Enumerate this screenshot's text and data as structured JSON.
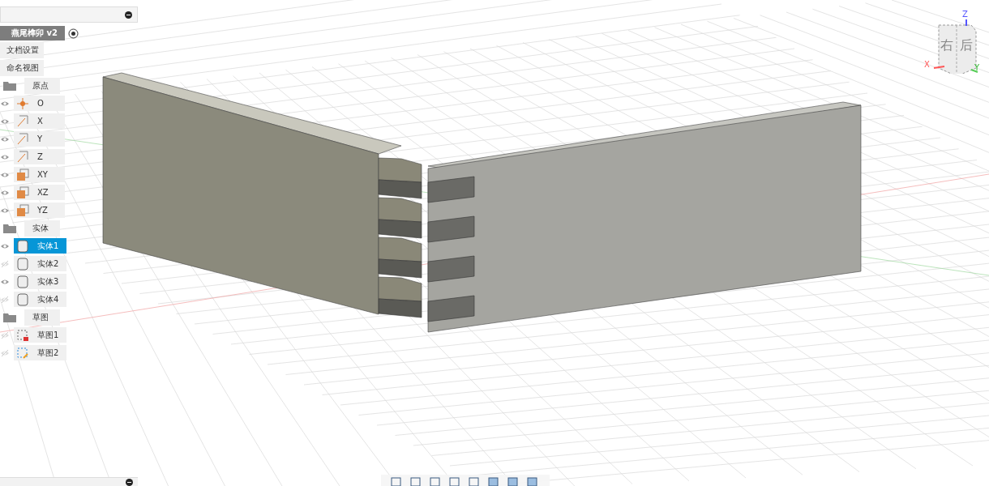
{
  "browser": {
    "document": {
      "title": "燕尾榫卯 v2"
    },
    "settings": [
      {
        "label": "文档设置"
      },
      {
        "label": "命名视图"
      }
    ],
    "folders": [
      {
        "label": "原点",
        "children": [
          {
            "label": "O",
            "kind": "point",
            "visible": true,
            "selected": false
          },
          {
            "label": "X",
            "kind": "axis",
            "visible": true,
            "selected": false
          },
          {
            "label": "Y",
            "kind": "axis",
            "visible": true,
            "selected": false
          },
          {
            "label": "Z",
            "kind": "axis",
            "visible": true,
            "selected": false
          },
          {
            "label": "XY",
            "kind": "plane",
            "visible": true,
            "selected": false
          },
          {
            "label": "XZ",
            "kind": "plane",
            "visible": true,
            "selected": false
          },
          {
            "label": "YZ",
            "kind": "plane",
            "visible": true,
            "selected": false
          }
        ]
      },
      {
        "label": "实体",
        "children": [
          {
            "label": "实体1",
            "kind": "body",
            "visible": true,
            "selected": true
          },
          {
            "label": "实体2",
            "kind": "body",
            "visible": false,
            "selected": false
          },
          {
            "label": "实体3",
            "kind": "body",
            "visible": true,
            "selected": false
          },
          {
            "label": "实体4",
            "kind": "body",
            "visible": false,
            "selected": false
          }
        ]
      },
      {
        "label": "草图",
        "children": [
          {
            "label": "草图1",
            "kind": "sketch-locked",
            "visible": false,
            "selected": false
          },
          {
            "label": "草图2",
            "kind": "sketch",
            "visible": false,
            "selected": false
          }
        ]
      }
    ]
  },
  "viewcube": {
    "faces": [
      "右",
      "后"
    ],
    "axes": [
      "X",
      "Y",
      "Z"
    ]
  }
}
